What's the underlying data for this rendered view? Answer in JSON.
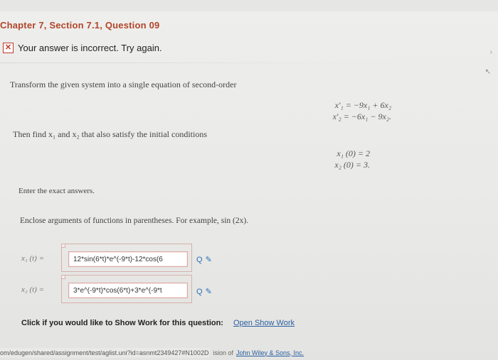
{
  "header": {
    "chapter_title": "Chapter 7, Section 7.1, Question 09"
  },
  "feedback": {
    "icon": "x-icon",
    "message": "Your answer is incorrect.  Try again."
  },
  "question": {
    "instruction_1": "Transform the given system into a single equation of second-order",
    "system": [
      "x′₁ = −9x₁ + 6x₂",
      "x′₂ = −6x₁ − 9x₂."
    ],
    "instruction_2": "Then find x₁ and x₂ that also satisfy the initial conditions",
    "initial_conditions": [
      "x₁ (0) = 2",
      "x₂ (0) = 3."
    ],
    "instruction_3": "Enter the exact answers.",
    "instruction_4": "Enclose arguments of functions in parentheses. For example, sin (2x)."
  },
  "answers": [
    {
      "label": "x₁ (t) =",
      "value": "12*sin(6*t)*e^(-9*t)-12*cos(6"
    },
    {
      "label": "x₂ (t) =",
      "value": "3*e^(-9*t)*cos(6*t)+3*e^(-9*t"
    }
  ],
  "show_work": {
    "label": "Click if you would like to Show Work for this question:",
    "link": "Open Show Work"
  },
  "status_bar": {
    "url": "om/edugen/shared/assignment/test/aglist.uni?id=asnmt2349427#N1002D",
    "copyright_prefix": "ision of",
    "copyright_link": "John Wiley & Sons, Inc."
  }
}
